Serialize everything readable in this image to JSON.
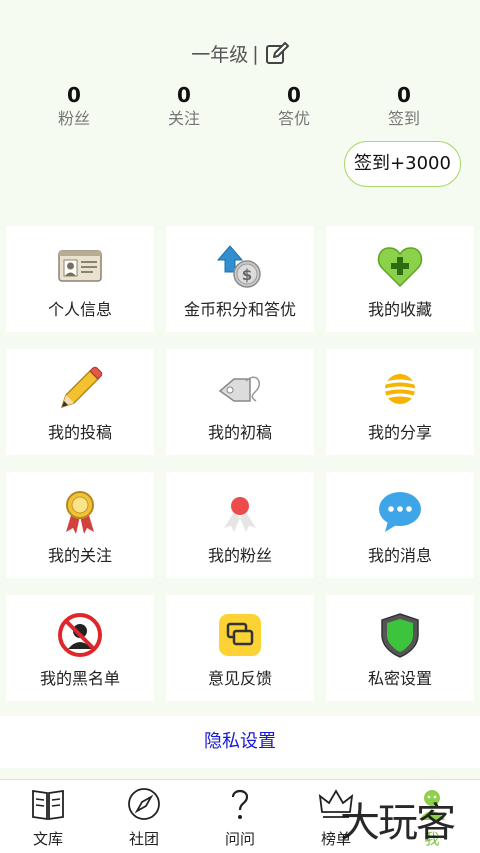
{
  "profile": {
    "grade": "一年级",
    "separator": "|"
  },
  "stats": [
    {
      "value": "0",
      "label": "粉丝"
    },
    {
      "value": "0",
      "label": "关注"
    },
    {
      "value": "0",
      "label": "答优"
    },
    {
      "value": "0",
      "label": "签到"
    }
  ],
  "checkin": {
    "label": "签到+3000"
  },
  "menu": [
    {
      "label": "个人信息",
      "icon": "id-card-icon"
    },
    {
      "label": "金币积分和答优",
      "icon": "coin-upload-icon"
    },
    {
      "label": "我的收藏",
      "icon": "heart-plus-icon"
    },
    {
      "label": "我的投稿",
      "icon": "pencil-icon"
    },
    {
      "label": "我的初稿",
      "icon": "tag-icon"
    },
    {
      "label": "我的分享",
      "icon": "share-ball-icon"
    },
    {
      "label": "我的关注",
      "icon": "medal-icon"
    },
    {
      "label": "我的粉丝",
      "icon": "ribbon-icon"
    },
    {
      "label": "我的消息",
      "icon": "chat-bubble-icon"
    },
    {
      "label": "我的黑名单",
      "icon": "blocked-icon"
    },
    {
      "label": "意见反馈",
      "icon": "feedback-icon"
    },
    {
      "label": "私密设置",
      "icon": "shield-icon"
    }
  ],
  "privacy_link": "隐私设置",
  "nav": [
    {
      "label": "文库",
      "icon": "book-icon"
    },
    {
      "label": "社团",
      "icon": "compass-icon"
    },
    {
      "label": "问问",
      "icon": "question-icon"
    },
    {
      "label": "榜单",
      "icon": "crown-icon"
    },
    {
      "label": "我",
      "icon": "person-icon"
    }
  ],
  "watermark": "大玩客",
  "colors": {
    "accent_green": "#a8d96c",
    "link_blue": "#1a1ad6",
    "background": "#f5fbf0"
  }
}
